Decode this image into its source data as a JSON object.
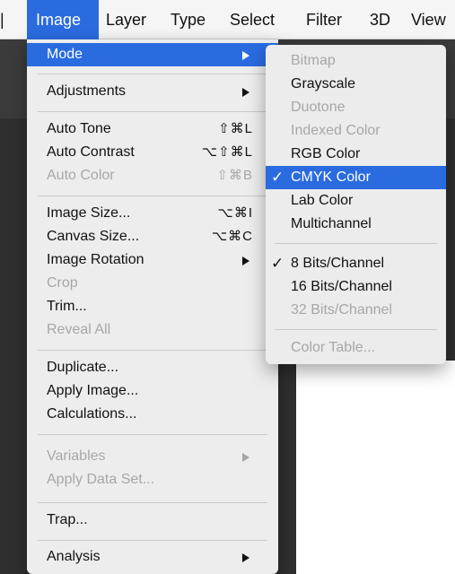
{
  "menubar": {
    "fragment": "|",
    "items": [
      {
        "label": "Image",
        "active": true
      },
      {
        "label": "Layer"
      },
      {
        "label": "Type"
      },
      {
        "label": "Select"
      },
      {
        "label": "Filter"
      },
      {
        "label": "3D"
      },
      {
        "label": "View"
      }
    ]
  },
  "image_menu": {
    "mode": {
      "label": "Mode"
    },
    "adjustments": {
      "label": "Adjustments"
    },
    "auto_tone": {
      "label": "Auto Tone",
      "shortcut": "⇧⌘L"
    },
    "auto_contrast": {
      "label": "Auto Contrast",
      "shortcut": "⌥⇧⌘L"
    },
    "auto_color": {
      "label": "Auto Color",
      "shortcut": "⇧⌘B"
    },
    "image_size": {
      "label": "Image Size...",
      "shortcut": "⌥⌘I"
    },
    "canvas_size": {
      "label": "Canvas Size...",
      "shortcut": "⌥⌘C"
    },
    "image_rotation": {
      "label": "Image Rotation"
    },
    "crop": {
      "label": "Crop"
    },
    "trim": {
      "label": "Trim..."
    },
    "reveal_all": {
      "label": "Reveal All"
    },
    "duplicate": {
      "label": "Duplicate..."
    },
    "apply_image": {
      "label": "Apply Image..."
    },
    "calculations": {
      "label": "Calculations..."
    },
    "variables": {
      "label": "Variables"
    },
    "apply_data_set": {
      "label": "Apply Data Set..."
    },
    "trap": {
      "label": "Trap..."
    },
    "analysis": {
      "label": "Analysis"
    }
  },
  "mode_submenu": {
    "check_mark": "✓",
    "bitmap": {
      "label": "Bitmap"
    },
    "grayscale": {
      "label": "Grayscale"
    },
    "duotone": {
      "label": "Duotone"
    },
    "indexed_color": {
      "label": "Indexed Color"
    },
    "rgb_color": {
      "label": "RGB Color"
    },
    "cmyk_color": {
      "label": "CMYK Color",
      "checked": true
    },
    "lab_color": {
      "label": "Lab Color"
    },
    "multichannel": {
      "label": "Multichannel"
    },
    "bits_8": {
      "label": "8 Bits/Channel",
      "checked": true
    },
    "bits_16": {
      "label": "16 Bits/Channel"
    },
    "bits_32": {
      "label": "32 Bits/Channel"
    },
    "color_table": {
      "label": "Color Table..."
    }
  },
  "colors": {
    "highlight": "#2a6be0",
    "disabled_text": "#a7a7a7",
    "menu_bg": "#ededed"
  }
}
